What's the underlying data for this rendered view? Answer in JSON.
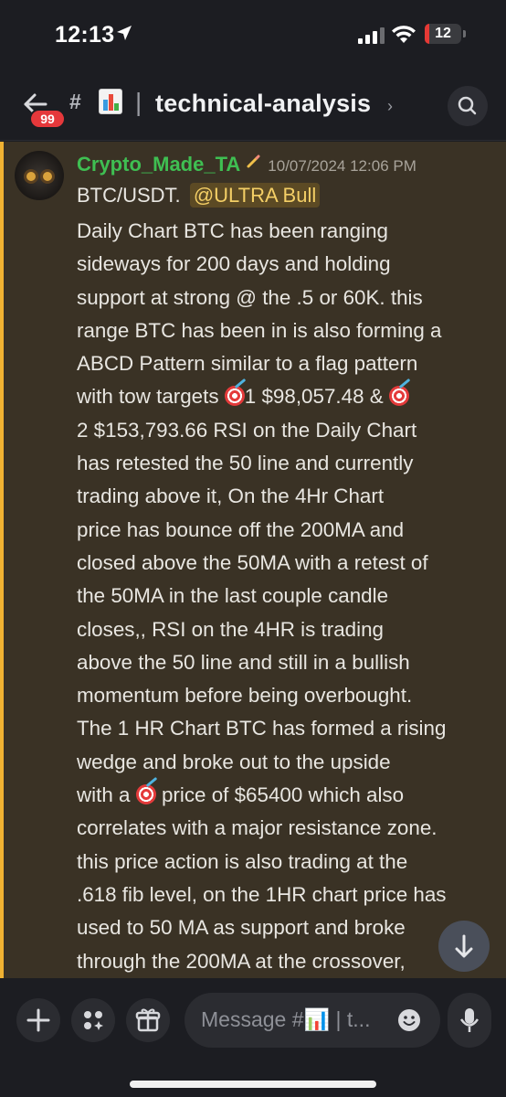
{
  "status_bar": {
    "time": "12:13",
    "battery_level": "12",
    "battery_fraction": 0.12
  },
  "header": {
    "unread_badge": "99",
    "hash": "#",
    "separator": "|",
    "channel_name": "technical-analysis",
    "chevron": "›",
    "icons": {
      "back": "back-arrow-icon",
      "emoji": "chart-emoji-icon",
      "search": "search-icon"
    }
  },
  "message": {
    "author": "Crypto_Made_TA",
    "author_color": "#3fbf52",
    "timestamp": "10/07/2024 12:06 PM",
    "first_line_text": "BTC/USDT.",
    "mention": "@ULTRA Bull",
    "body_lines": [
      [
        "Daily Chart BTC has been ranging"
      ],
      [
        "sideways for 200 days and holding"
      ],
      [
        "support at strong @ the .5 or 60K.  this"
      ],
      [
        "range BTC has been in is also forming a"
      ],
      [
        "ABCD Pattern similar to a flag pattern"
      ],
      [
        "with tow targets ",
        "1   $98,057.48   & ",
        ""
      ],
      [
        "2   $153,793.66     RSI on the Daily Chart"
      ],
      [
        "has retested the 50 line and currently"
      ],
      [
        "trading above  it,   On the 4Hr Chart"
      ],
      [
        "price has bounce off the 200MA and"
      ],
      [
        "closed above the 50MA with a retest of"
      ],
      [
        "the 50MA in the last couple candle"
      ],
      [
        "closes,,  RSI  on the 4HR is trading"
      ],
      [
        "above the 50 line and still in a bullish"
      ],
      [
        "momentum before being overbought."
      ],
      [
        "The 1 HR Chart BTC has formed a rising"
      ],
      [
        "wedge and broke out to the upside"
      ],
      [
        "with a ",
        " price of $65400 which also"
      ],
      [
        "correlates with a major resistance zone."
      ],
      [
        "this price action is also trading at the"
      ],
      [
        ".618 fib level, on the 1HR chart price has"
      ],
      [
        "used to 50 MA as support and broke"
      ],
      [
        "through the 200MA at the crossover,"
      ]
    ],
    "mention_highlight_color": "#f0b232"
  },
  "composer": {
    "placeholder": "Message #📊 | t...",
    "buttons": {
      "add": "plus-icon",
      "apps": "apps-icon",
      "gift": "gift-icon",
      "emoji": "emoji-icon",
      "mic": "microphone-icon"
    }
  },
  "scroll_button": "arrow-down-icon"
}
